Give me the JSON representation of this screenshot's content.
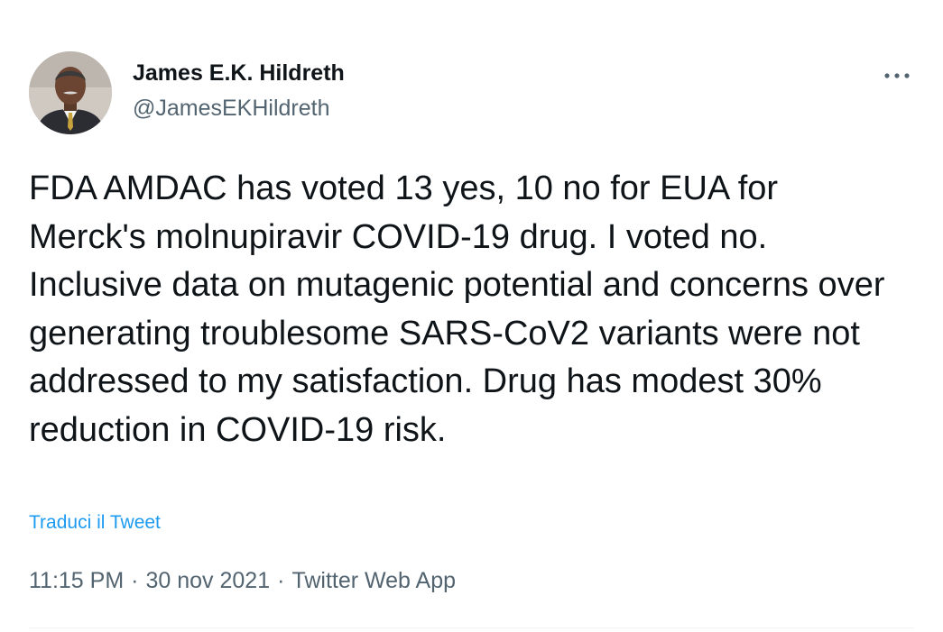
{
  "author": {
    "display_name": "James E.K. Hildreth",
    "handle": "@JamesEKHildreth",
    "avatar_icon": "profile-photo"
  },
  "more_menu": {
    "icon": "more-horizontal-icon",
    "label": "•••"
  },
  "tweet": {
    "text": "FDA AMDAC has voted 13 yes, 10 no for EUA for Merck's molnupiravir COVID-19 drug. I voted no. Inclusive data on mutagenic potential and concerns over generating troublesome SARS-CoV2 variants were not addressed to my satisfaction. Drug has modest 30% reduction in COVID-19 risk.",
    "translate_link": "Traduci il Tweet"
  },
  "meta": {
    "time": "11:15 PM",
    "separator": "·",
    "date": "30 nov 2021",
    "source": "Twitter Web App"
  },
  "colors": {
    "link": "#1d9bf0",
    "secondary_text": "#536471",
    "primary_text": "#0f1419",
    "divider": "#eff3f4"
  }
}
